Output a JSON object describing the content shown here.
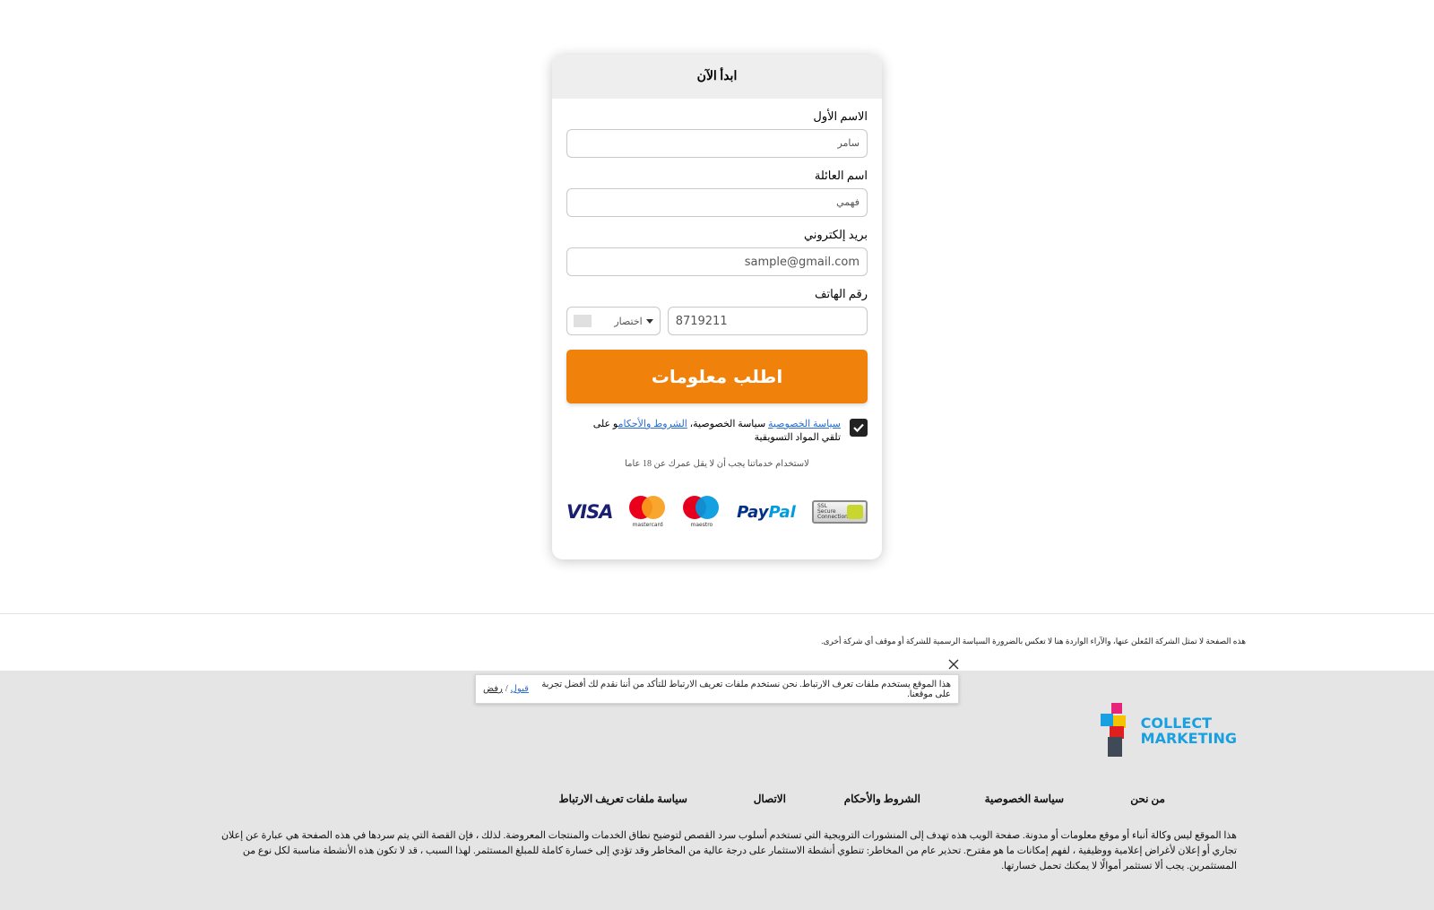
{
  "form": {
    "header": "ابدأ الآن",
    "first_name": {
      "label": "الاسم الأول",
      "placeholder": "سامر"
    },
    "last_name": {
      "label": "اسم العائلة",
      "placeholder": "فهمي"
    },
    "email": {
      "label": "بريد إلكتروني",
      "placeholder": "sample@gmail.com"
    },
    "phone": {
      "label": "رقم الهاتف",
      "prefix_label": "اختصار",
      "placeholder": "8719211"
    },
    "submit_label": "اطلب معلومات",
    "consent": {
      "checked": true,
      "privacy_link": "سياسة الخصوصية",
      "text_privacy": "سياسة الخصوصية،",
      "terms_link": "الشروط والأحكام",
      "text_marketing": "و على تلقي المواد التسويقية"
    },
    "age_note": "لاستخدام خدماتنا يجب أن لا يقل عمرك عن 18 عاما"
  },
  "payments": {
    "visa": "VISA",
    "mastercard": "mastercard",
    "maestro": "maestro",
    "paypal_a": "Pay",
    "paypal_b": "Pal",
    "ssl": [
      "SSL",
      "Secure",
      "Connection"
    ]
  },
  "disclaimer_top": "هذه الصفحة لا تمثل الشركة المُعلن عنها، والآراء الواردة هنا لا تعكس بالضرورة السياسة الرسمية للشركة أو موقف أي شركة أخرى.",
  "cookie": {
    "text": "هذا الموقع يستخدم ملفات تعرف الارتباط. نحن نستخدم ملفات تعريف الارتباط للتأكد من أننا نقدم لك أفضل تجربة على موقعنا.",
    "accept": "قبول",
    "separator": "/",
    "reject": "رفض"
  },
  "footer": {
    "logo_line1": "COLLECT",
    "logo_line2": "MARKETING",
    "links": {
      "about": "من نحن",
      "privacy": "سياسة الخصوصية",
      "terms": "الشروط والأحكام",
      "contact": "الاتصال",
      "cookies": "سياسة ملفات تعريف الارتباط"
    },
    "text": "هذا الموقع ليس وكالة أنباء أو موقع معلومات أو مدونة. صفحة الويب هذه تهدف إلى المنشورات الترويجية التي تستخدم أسلوب سرد القصص لتوضيح نطاق الخدمات والمنتجات المعروضة. لذلك ، فإن القصة التي يتم سردها في هذه الصفحة هي عبارة عن إعلان تجاري أو إعلان لأغراض إعلامية ووظيفية ، لفهم إمكانات ما هو مقترح. تحذير عام من المخاطر: تنطوي أنشطة الاستثمار على درجة عالية من المخاطر وقد تؤدي إلى خسارة كاملة للمبلغ المستثمر. لهذا السبب ، قد لا تكون هذه الأنشطة مناسبة لكل نوع من المستثمرين. يجب ألا تستثمر أموالًا لا يمكنك تحمل خسارتها."
  },
  "colors": {
    "submit": "#f0810a",
    "link": "#2a6ed1",
    "footer_bg": "#e5e5e5",
    "logo_blue": "#18a0e0"
  }
}
